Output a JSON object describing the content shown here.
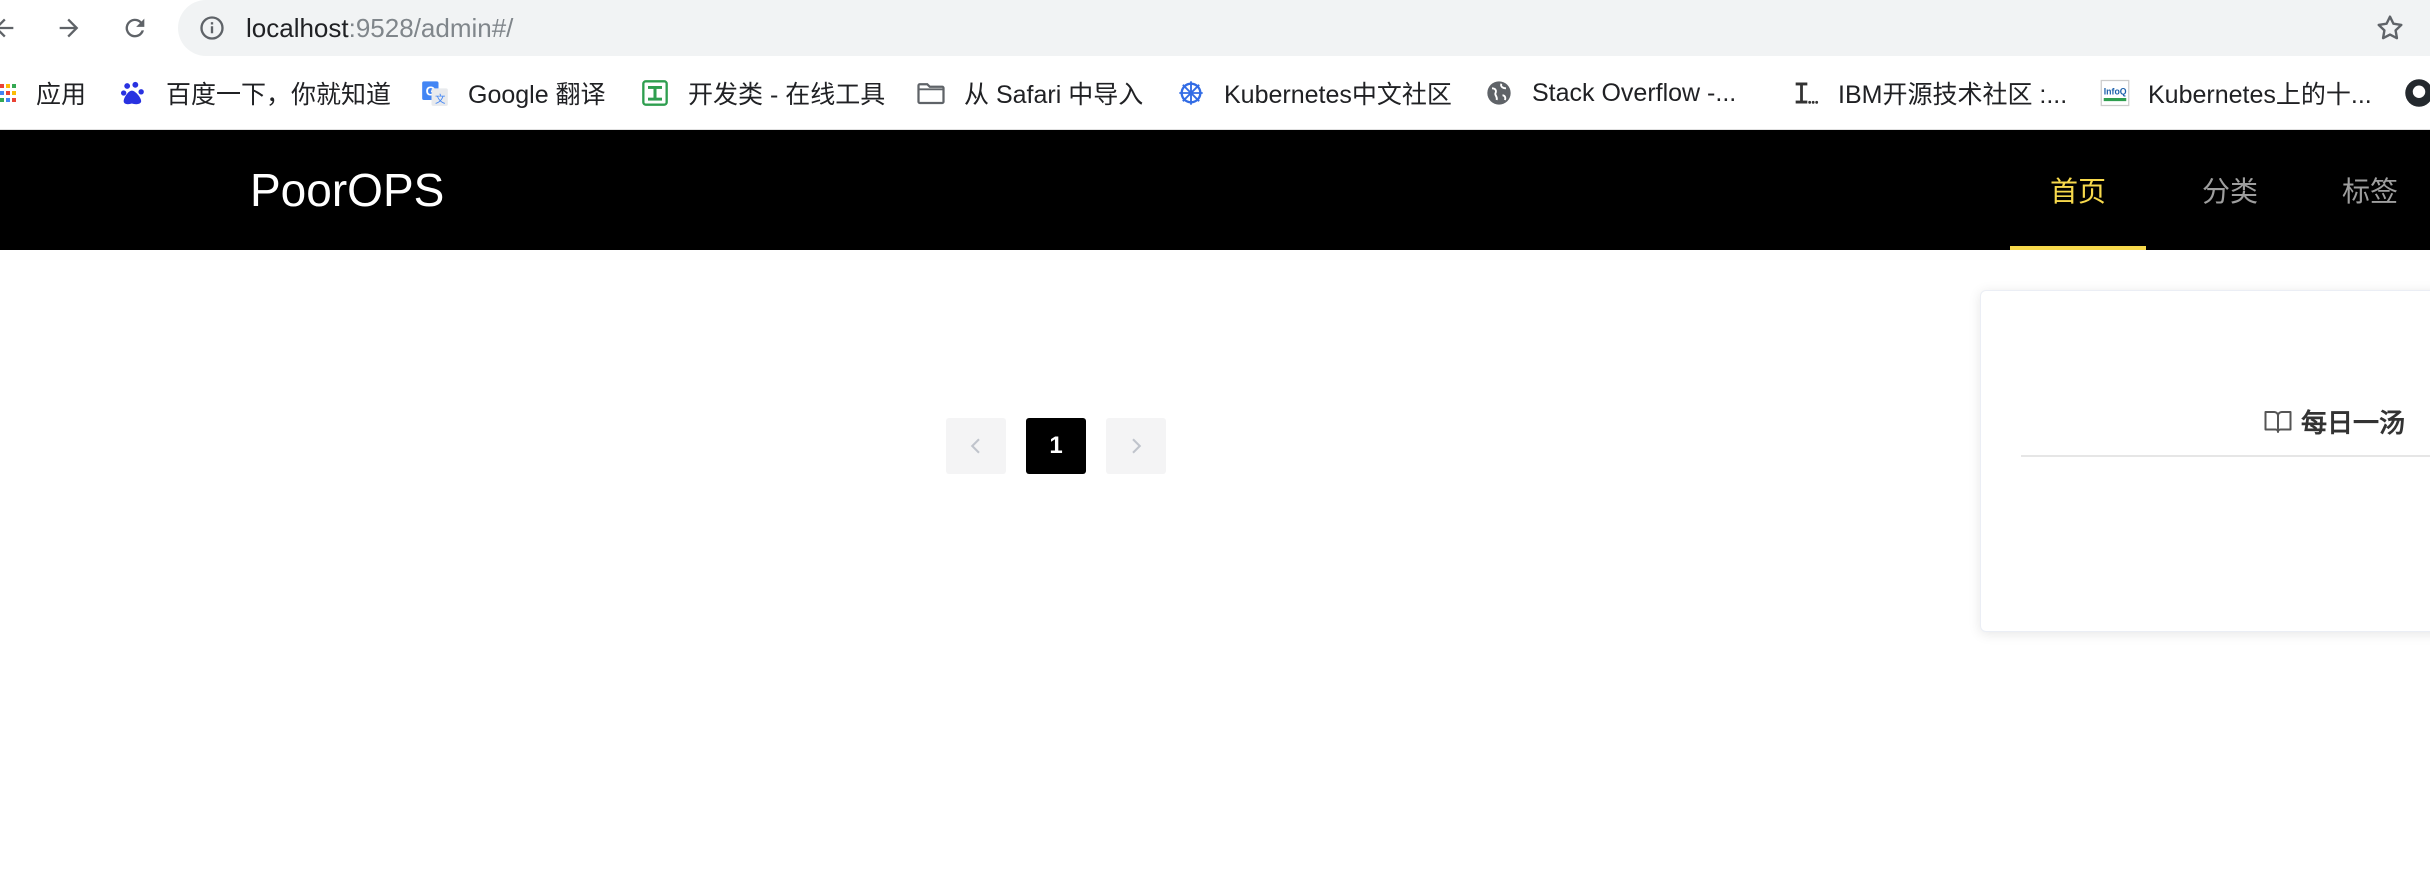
{
  "browser": {
    "url_host": "localhost",
    "url_path": ":9528/admin#/"
  },
  "bookmarks": [
    {
      "label": "应用",
      "icon": "apps-grid-icon"
    },
    {
      "label": "百度一下，你就知道",
      "icon": "baidu-paw-icon"
    },
    {
      "label": "Google 翻译",
      "icon": "google-translate-icon"
    },
    {
      "label": "开发类 - 在线工具",
      "icon": "tool-icon"
    },
    {
      "label": "从 Safari 中导入",
      "icon": "folder-icon"
    },
    {
      "label": "Kubernetes中文社区",
      "icon": "kubernetes-icon"
    },
    {
      "label": "Stack Overflow -...",
      "icon": "globe-icon"
    },
    {
      "label": "IBM开源技术社区 :...",
      "icon": "ibm-icon"
    },
    {
      "label": "Kubernetes上的十...",
      "icon": "infoq-icon"
    }
  ],
  "app": {
    "logo": "PoorOPS",
    "nav": {
      "home": "首页",
      "category": "分类",
      "tags": "标签"
    },
    "accent_color": "#f7d94c"
  },
  "pagination": {
    "current_page": "1"
  },
  "side_card": {
    "title": "每日一汤",
    "icon": "book-open-icon"
  }
}
